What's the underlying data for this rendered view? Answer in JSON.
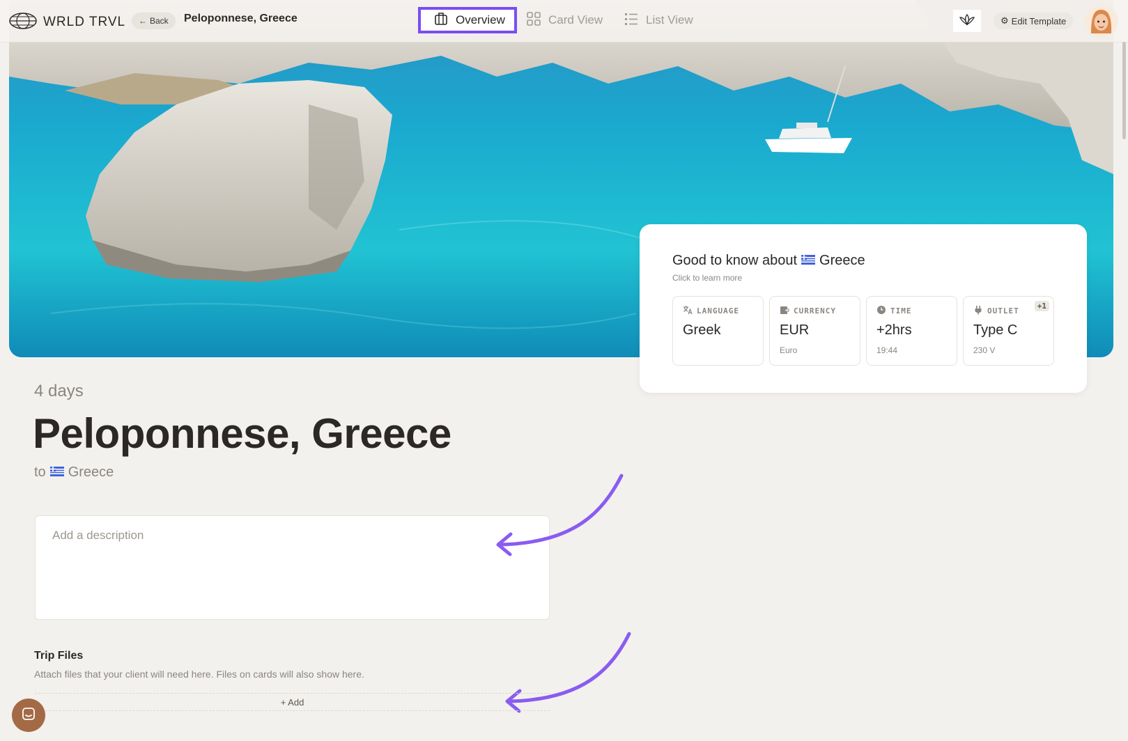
{
  "app": {
    "logo_text": "WRLD TRVL"
  },
  "nav": {
    "back_label": "Back",
    "breadcrumb": "Peloponnese, Greece",
    "tabs": [
      {
        "label": "Overview",
        "active": true
      },
      {
        "label": "Card View",
        "active": false
      },
      {
        "label": "List View",
        "active": false
      }
    ],
    "edit_template_label": "Edit Template"
  },
  "know": {
    "title_prefix": "Good to know about",
    "country": "Greece",
    "subtitle": "Click to learn more",
    "tiles": [
      {
        "label": "LANGUAGE",
        "value": "Greek",
        "sub": ""
      },
      {
        "label": "CURRENCY",
        "value": "EUR",
        "sub": "Euro"
      },
      {
        "label": "TIME",
        "value": "+2hrs",
        "sub": "19:44"
      },
      {
        "label": "OUTLET",
        "value": "Type C",
        "sub": "230 V",
        "badge": "+1"
      }
    ]
  },
  "trip": {
    "duration": "4 days",
    "title": "Peloponnese, Greece",
    "to_prefix": "to",
    "to_country": "Greece",
    "description_placeholder": "Add a description"
  },
  "files": {
    "title": "Trip Files",
    "subtitle": "Attach files that your client will need here. Files on cards will also show here.",
    "add_label": "+ Add"
  },
  "colors": {
    "accent": "#7b4df2",
    "background": "#f3f1ee",
    "chat": "#a46a46"
  }
}
